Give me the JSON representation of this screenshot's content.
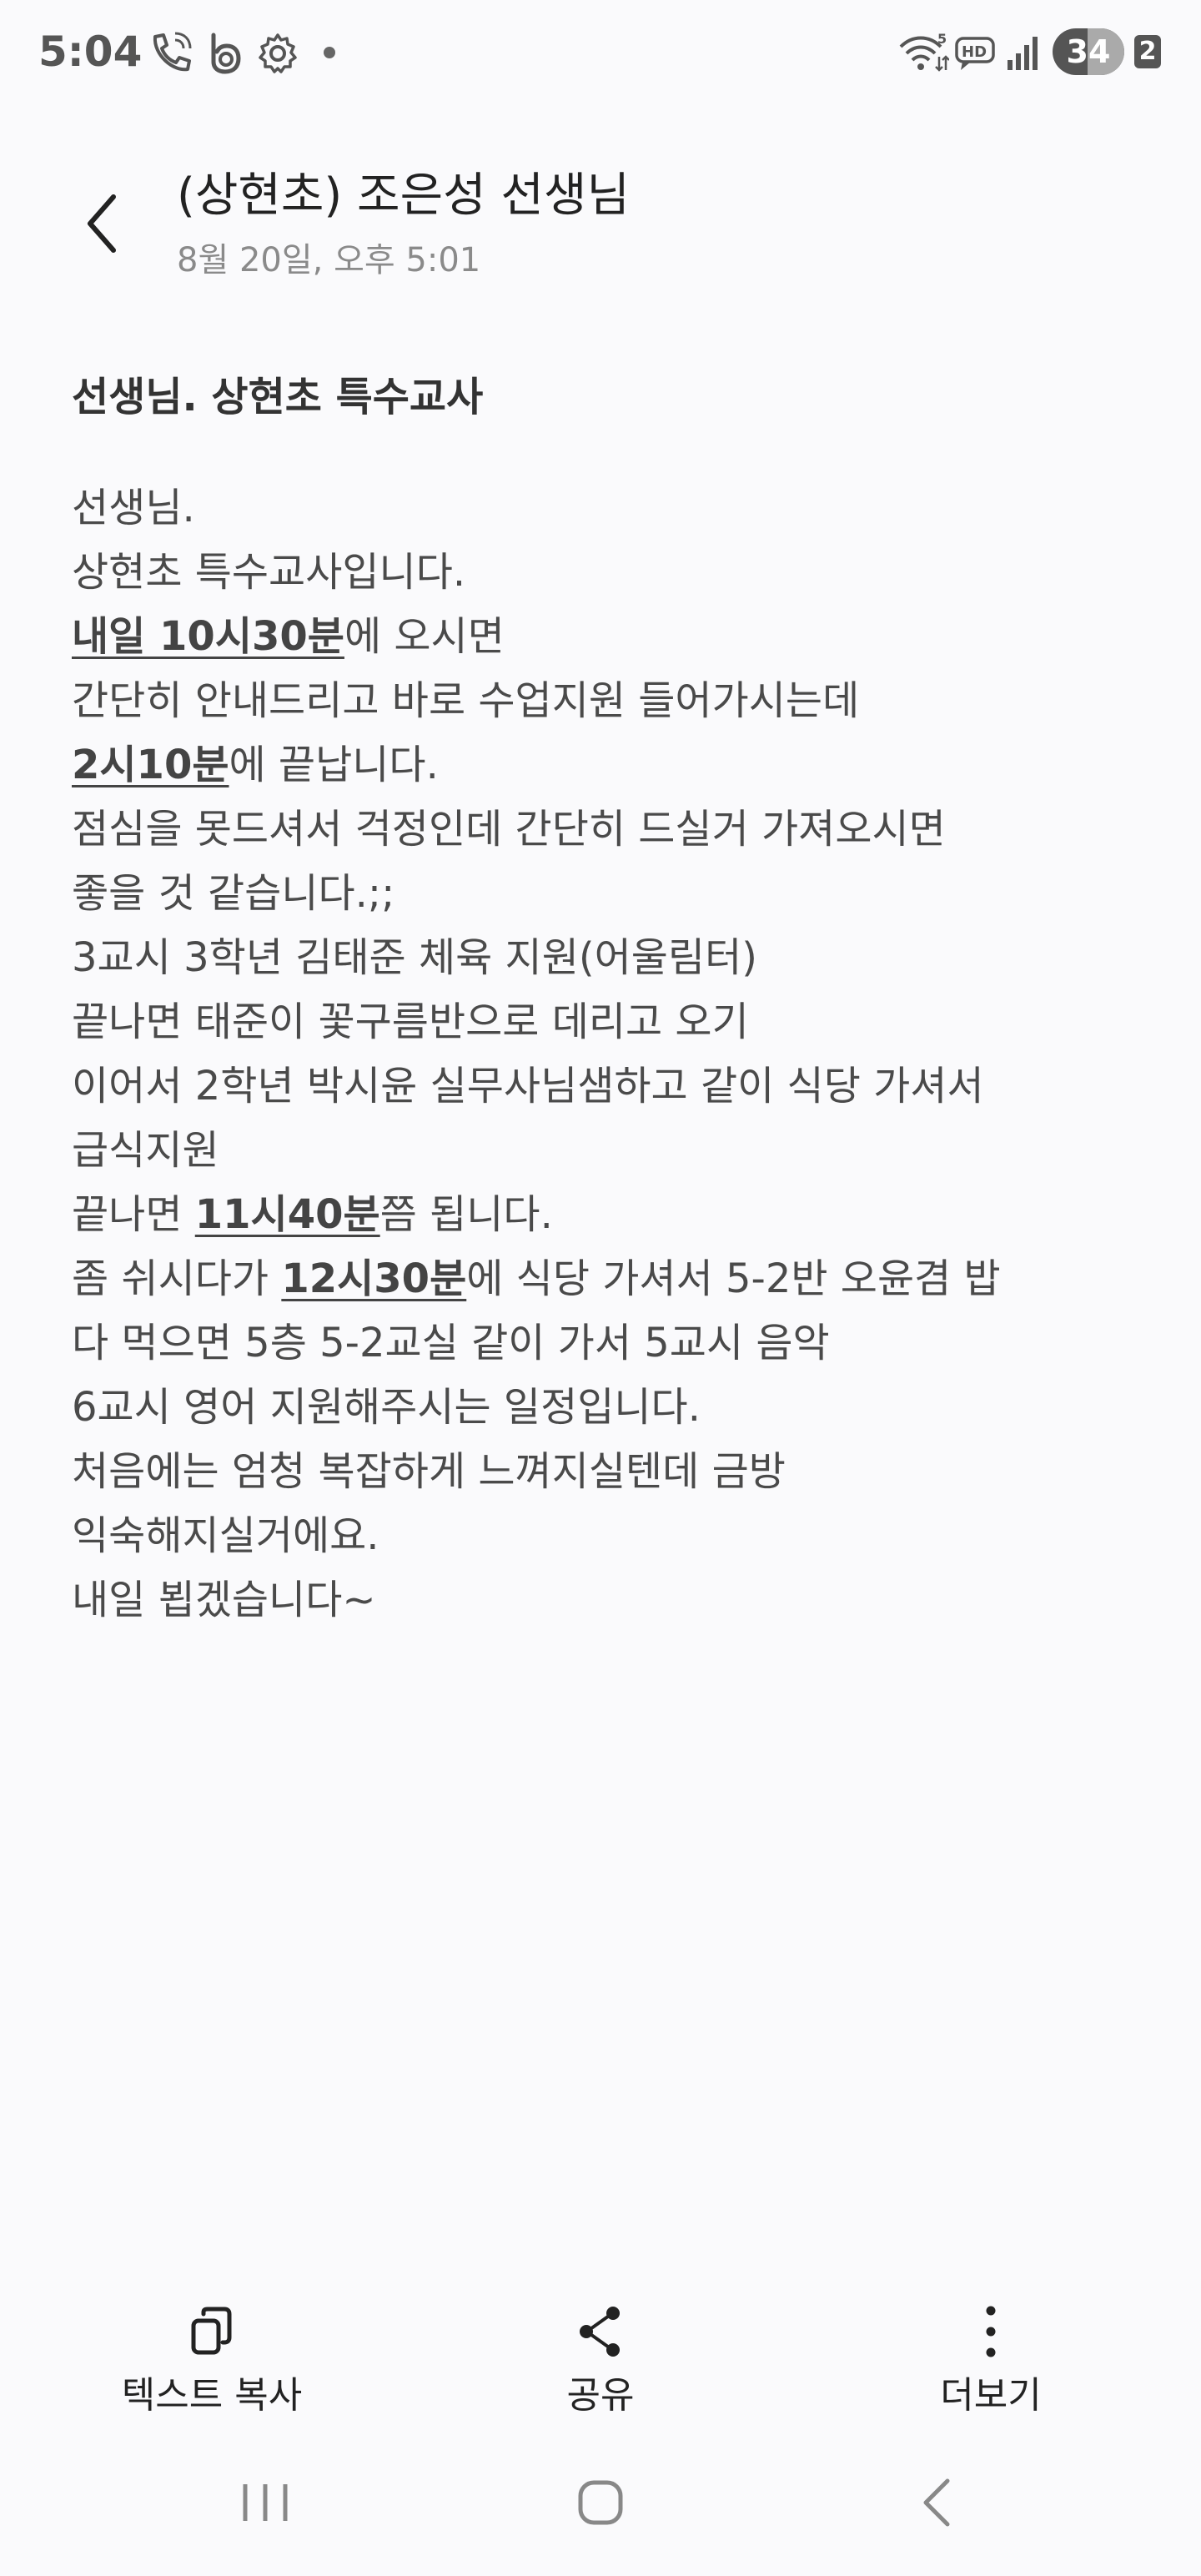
{
  "status_bar": {
    "time": "5:04",
    "battery_level": "34",
    "sim_slot": "2",
    "icons": [
      "phone-wifi-call-icon",
      "b-app-icon",
      "gear-icon",
      "dot-icon",
      "wifi-icon",
      "hd-voice-icon",
      "signal-icon",
      "battery-icon"
    ]
  },
  "header": {
    "title": "(상현초) 조은성 선생님",
    "date": "8월 20일, 오후 5:01",
    "back_icon": "chevron-left-icon"
  },
  "message": {
    "subject": "선생님. 상현초 특수교사",
    "lines": [
      {
        "segments": [
          {
            "text": "선생님.",
            "bold": false
          }
        ]
      },
      {
        "segments": [
          {
            "text": "상현초 특수교사입니다.",
            "bold": false
          }
        ]
      },
      {
        "segments": [
          {
            "text": "내일 10시30분",
            "bold": true
          },
          {
            "text": "에 오시면",
            "bold": false
          }
        ]
      },
      {
        "segments": [
          {
            "text": "간단히 안내드리고 바로 수업지원 들어가시는데",
            "bold": false
          }
        ]
      },
      {
        "segments": [
          {
            "text": "2시10분",
            "bold": true
          },
          {
            "text": "에 끝납니다.",
            "bold": false
          }
        ]
      },
      {
        "segments": [
          {
            "text": "점심을 못드셔서 걱정인데 간단히 드실거 가져오시면",
            "bold": false
          }
        ]
      },
      {
        "segments": [
          {
            "text": "좋을 것 같습니다.;;",
            "bold": false
          }
        ]
      },
      {
        "segments": [
          {
            "text": "3교시 3학년 김태준 체육 지원(어울림터)",
            "bold": false
          }
        ]
      },
      {
        "segments": [
          {
            "text": "끝나면 태준이 꽃구름반으로 데리고 오기",
            "bold": false
          }
        ]
      },
      {
        "segments": [
          {
            "text": "이어서 2학년 박시윤 실무사님샘하고 같이 식당 가셔서",
            "bold": false
          }
        ]
      },
      {
        "segments": [
          {
            "text": "급식지원",
            "bold": false
          }
        ]
      },
      {
        "segments": [
          {
            "text": "끝나면 ",
            "bold": false
          },
          {
            "text": "11시40분",
            "bold": true
          },
          {
            "text": "쯤 됩니다.",
            "bold": false
          }
        ]
      },
      {
        "segments": [
          {
            "text": "좀 쉬시다가 ",
            "bold": false
          },
          {
            "text": "12시30분",
            "bold": true
          },
          {
            "text": "에 식당 가셔서 5-2반 오윤겸 밥",
            "bold": false
          }
        ]
      },
      {
        "segments": [
          {
            "text": "다 먹으면 5층 5-2교실 같이 가서 5교시 음악",
            "bold": false
          }
        ]
      },
      {
        "segments": [
          {
            "text": "6교시 영어 지원해주시는 일정입니다.",
            "bold": false
          }
        ]
      },
      {
        "segments": [
          {
            "text": "처음에는 엄청 복잡하게 느껴지실텐데 금방",
            "bold": false
          }
        ]
      },
      {
        "segments": [
          {
            "text": "익숙해지실거에요.",
            "bold": false
          }
        ]
      },
      {
        "segments": [
          {
            "text": "내일 뵙겠습니다~",
            "bold": false
          }
        ]
      }
    ]
  },
  "actions": {
    "copy_text": {
      "label": "텍스트 복사",
      "icon": "copy-icon"
    },
    "share": {
      "label": "공유",
      "icon": "share-icon"
    },
    "more": {
      "label": "더보기",
      "icon": "more-vertical-icon"
    }
  },
  "nav": {
    "recents_icon": "recents-icon",
    "home_icon": "home-icon",
    "back_icon": "nav-back-icon"
  }
}
